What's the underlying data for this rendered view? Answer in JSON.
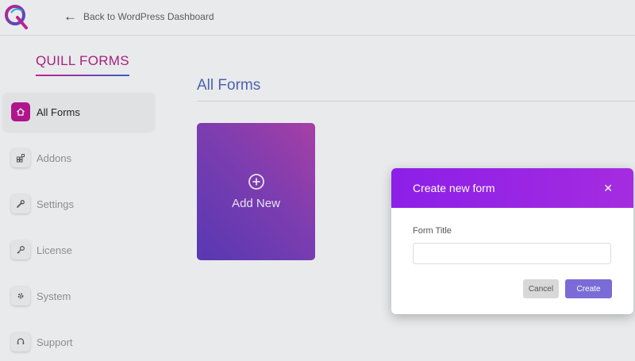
{
  "topbar": {
    "back_label": "Back to WordPress Dashboard",
    "back_icon": "arrow-left-icon",
    "logo_icon": "quill-q-logo"
  },
  "sidebar": {
    "brand": "QUILL FORMS",
    "items": [
      {
        "label": "All Forms",
        "icon": "home-icon",
        "active": true
      },
      {
        "label": "Addons",
        "icon": "addons-grid-icon",
        "active": false
      },
      {
        "label": "Settings",
        "icon": "wrench-icon",
        "active": false
      },
      {
        "label": "License",
        "icon": "key-icon",
        "active": false
      },
      {
        "label": "System",
        "icon": "gear-icon",
        "active": false
      },
      {
        "label": "Support",
        "icon": "headset-icon",
        "active": false
      }
    ]
  },
  "main": {
    "title": "All Forms",
    "add_card_label": "Add New",
    "add_card_icon": "plus-circle-icon"
  },
  "modal": {
    "title": "Create new form",
    "close_icon": "close-icon",
    "field_label": "Form Title",
    "field_value": "",
    "field_placeholder": "",
    "cancel_label": "Cancel",
    "create_label": "Create"
  },
  "colors": {
    "accent": "#b0168b",
    "brand_title": "#a3227f",
    "modal_header": "#9526e5",
    "create_button": "#7b6bd6",
    "card_gradient_start": "#3e1aa8",
    "card_gradient_end": "#9b2299"
  }
}
